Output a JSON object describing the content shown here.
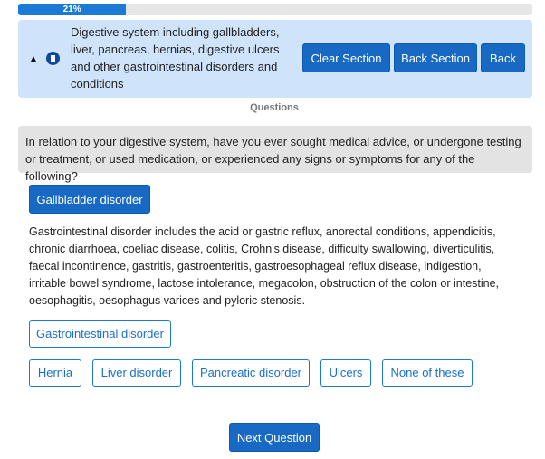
{
  "progress": {
    "percent": 21,
    "label": "21%"
  },
  "section": {
    "title": "Digestive system including gallbladders, liver, pancreas, hernias, digestive ulcers and other gastrointestinal disorders and conditions",
    "buttons": {
      "clear": "Clear Section",
      "back_section": "Back Section",
      "back": "Back"
    }
  },
  "questions_label": "Questions",
  "question": {
    "text": "In relation to your digestive system, have you ever sought medical advice, or undergone testing or treatment, or used medication, or experienced any signs or symptoms for any of the following?"
  },
  "selected_option": "Gallbladder disorder",
  "description": "Gastrointestinal disorder includes the acid or gastric reflux, anorectal conditions, appendicitis, chronic diarrhoea, coeliac disease, colitis, Crohn's disease, difficulty swallowing, diverticulitis, faecal incontinence, gastritis, gastroenteritis, gastroesophageal reflux disease, indigestion, irritable bowel syndrome, lactose intolerance, megacolon, obstruction of the colon or intestine, oesophagitis, oesophagus varices and pyloric stenosis.",
  "options": {
    "gastro": "Gastrointestinal disorder",
    "hernia": "Hernia",
    "liver": "Liver disorder",
    "pancreatic": "Pancreatic disorder",
    "ulcers": "Ulcers",
    "none": "None of these"
  },
  "next_label": "Next Question",
  "colors": {
    "primary": "#1769c4",
    "header_bg": "#cfe3fb",
    "question_bg": "#e3e3e3"
  },
  "icons": {
    "collapse": "chevron-up-icon",
    "pause": "pause-icon"
  }
}
